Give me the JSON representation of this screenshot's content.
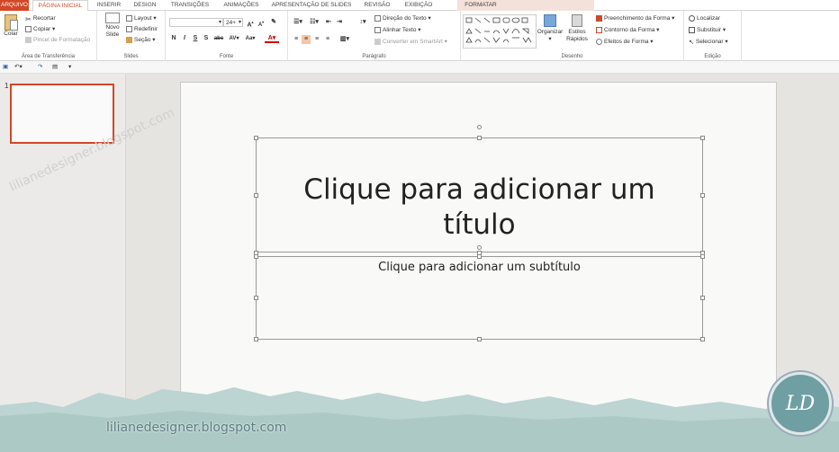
{
  "tabs": {
    "file": "ARQUIVO",
    "home": "PÁGINA INICIAL",
    "insert": "INSERIR",
    "design": "DESIGN",
    "transitions": "TRANSIÇÕES",
    "animations": "ANIMAÇÕES",
    "slideshow": "APRESENTAÇÃO DE SLIDES",
    "review": "REVISÃO",
    "view": "EXIBIÇÃO",
    "format": "FORMATAR"
  },
  "clipboard": {
    "paste": "Colar",
    "cut": "Recortar",
    "copy": "Copiar",
    "painter": "Pincel de Formatação",
    "label": "Área de Transferência"
  },
  "slides": {
    "new": "Novo",
    "new2": "Slide",
    "layout": "Layout",
    "reset": "Redefinir",
    "section": "Seção",
    "label": "Slides"
  },
  "font": {
    "size": "24+",
    "bold": "N",
    "italic": "I",
    "underline": "S",
    "shadow": "S",
    "strike": "abc",
    "spacing": "AV",
    "case": "Aa",
    "label": "Fonte"
  },
  "paragraph": {
    "direction": "Direção do Texto",
    "align": "Alinhar Texto",
    "smartart": "Converter em SmartArt",
    "label": "Parágrafo"
  },
  "drawing": {
    "arrange": "Organizar",
    "styles": "Estilos",
    "styles2": "Rápidos",
    "fill": "Preenchimento da Forma",
    "outline": "Contorno da Forma",
    "effects": "Efeitos de Forma",
    "label": "Desenho"
  },
  "editing": {
    "find": "Localizar",
    "replace": "Substituir",
    "select": "Selecionar",
    "label": "Edição"
  },
  "thumb": {
    "number": "1"
  },
  "slide": {
    "title": "Clique para adicionar um título",
    "subtitle": "Clique para adicionar um subtítulo"
  },
  "watermark": {
    "diag": "lilianedesigner.blogspot.com",
    "bottom": "lilianedesigner.blogspot.com",
    "logo": "LD"
  },
  "colors": {
    "accent": "#d24726",
    "file_tab": "#d24726",
    "context": "#f3e1da"
  }
}
